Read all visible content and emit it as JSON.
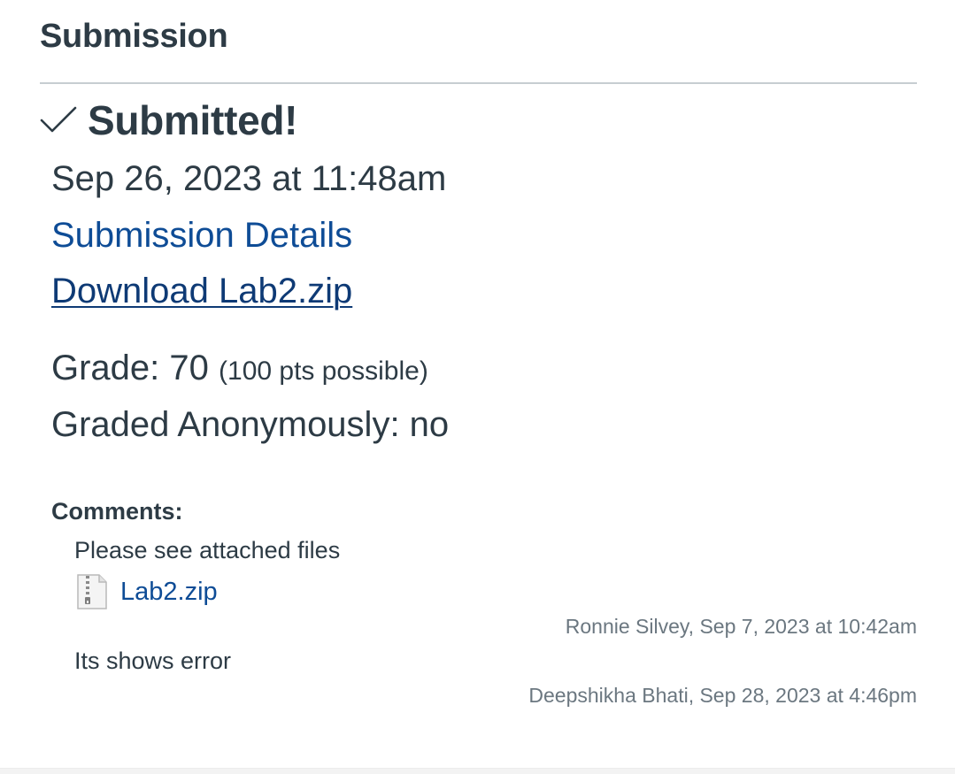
{
  "section": {
    "title": "Submission"
  },
  "status": {
    "icon": "checkmark-icon",
    "label": "Submitted!"
  },
  "submission": {
    "date": "Sep 26, 2023 at 11:48am",
    "details_link": "Submission Details",
    "download_link": "Download Lab2.zip"
  },
  "grade": {
    "label": "Grade: 70",
    "possible": "(100 pts possible)"
  },
  "anonymous": {
    "label": "Graded Anonymously: no"
  },
  "comments": {
    "label": "Comments:",
    "items": [
      {
        "text": "Please see attached files",
        "attachment": {
          "icon": "zip-file-icon",
          "name": "Lab2.zip"
        },
        "meta": "Ronnie Silvey, Sep 7, 2023 at 10:42am"
      },
      {
        "text": "Its shows error",
        "meta": "Deepshikha Bhati, Sep 28, 2023 at 4:46pm"
      }
    ]
  },
  "colors": {
    "text": "#2d3b45",
    "link": "#0e4c96",
    "meta": "#6b7780",
    "divider": "#c7cdd1"
  }
}
